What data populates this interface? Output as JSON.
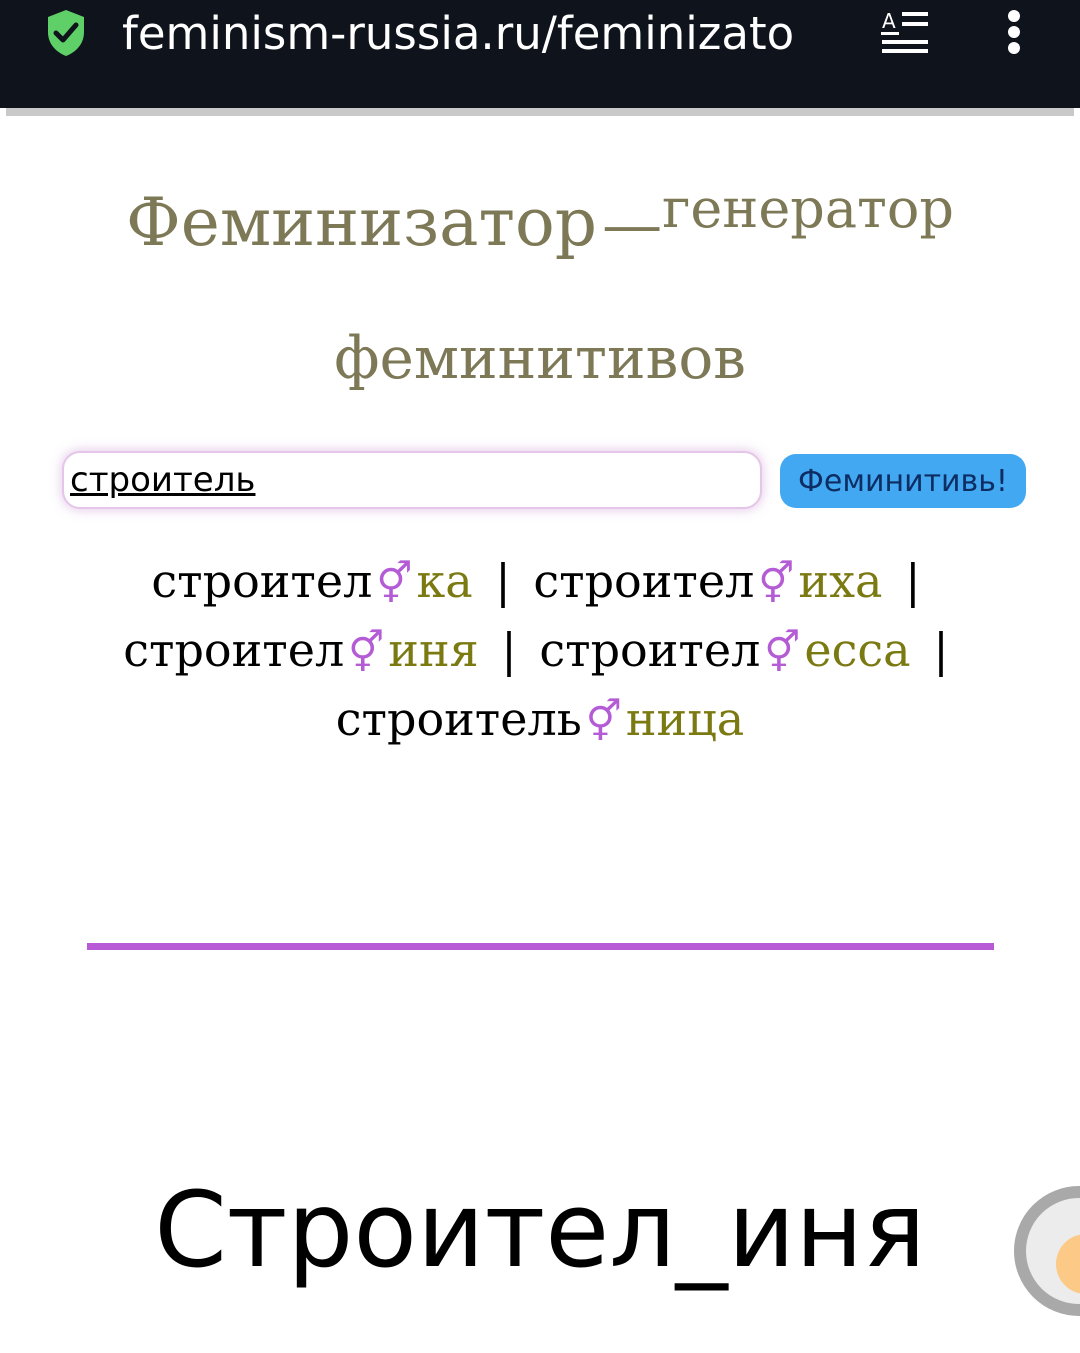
{
  "browser": {
    "url": "feminism-russia.ru/feminizato",
    "icons": {
      "secure": "shield-check-icon",
      "reader": "reader-mode-icon",
      "menu": "more-vertical-icon"
    },
    "colors": {
      "bar_bg": "#0f131c",
      "secure_icon": "#5fd068"
    }
  },
  "header": {
    "title_main": "Феминизатор",
    "title_dash": "—",
    "title_sup": "генератор",
    "title_line2": "феминитивов",
    "color": "#7d7856"
  },
  "search": {
    "value": "строитель",
    "button_label": "Феминитивь!",
    "button_color": "#42a8f2"
  },
  "results": {
    "symbol": "⚥",
    "separator": "|",
    "items": [
      {
        "stem": "строител",
        "suffix": "ка"
      },
      {
        "stem": "строител",
        "suffix": "иха"
      },
      {
        "stem": "строител",
        "suffix": "иня"
      },
      {
        "stem": "строител",
        "suffix": "есса"
      },
      {
        "stem": "строитель",
        "suffix": "ница"
      }
    ],
    "colors": {
      "symbol": "#b45bd6",
      "suffix": "#7b7a12"
    }
  },
  "divider_color": "#b85ad6",
  "big_result": "Строител_иня",
  "fab": {
    "icon": "scroll-up-icon",
    "glyph": "↑"
  }
}
